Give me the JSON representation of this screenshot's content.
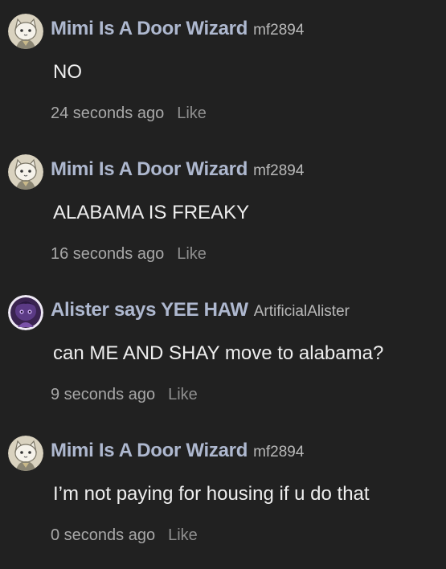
{
  "comments": [
    {
      "display_name": "Mimi Is A Door Wizard",
      "username": "mf2894",
      "text": "NO",
      "time": "24 seconds ago",
      "like_label": "Like",
      "avatar": "cat-avatar-icon"
    },
    {
      "display_name": "Mimi Is A Door Wizard",
      "username": "mf2894",
      "text": "ALABAMA IS FREAKY",
      "time": "16 seconds ago",
      "like_label": "Like",
      "avatar": "cat-avatar-icon"
    },
    {
      "display_name": "Alister says YEE HAW",
      "username": "ArtificialAlister",
      "text": "can ME AND SHAY move to alabama?",
      "time": "9 seconds ago",
      "like_label": "Like",
      "avatar": "purple-creature-avatar-icon"
    },
    {
      "display_name": "Mimi Is A Door Wizard",
      "username": "mf2894",
      "text": "I’m not paying for housing if u do that",
      "time": "0 seconds ago",
      "like_label": "Like",
      "avatar": "cat-avatar-icon"
    }
  ],
  "colors": {
    "background": "#212121",
    "display_name": "#aeb8cf",
    "body_text": "#eeeeee",
    "meta": "#a8a8a8"
  }
}
